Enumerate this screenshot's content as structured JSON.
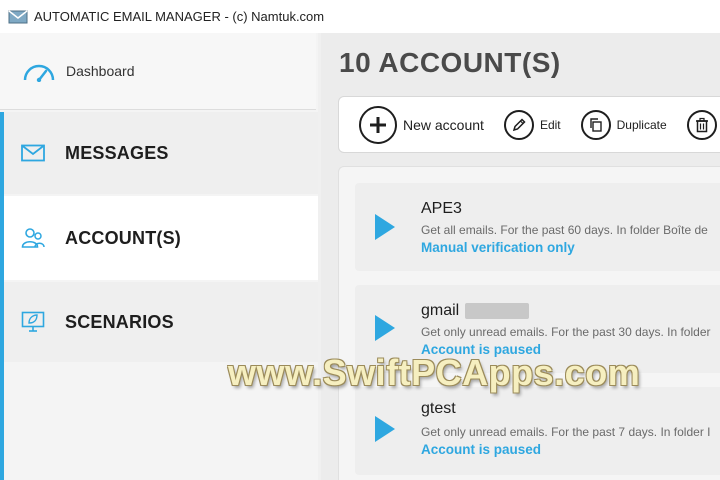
{
  "window": {
    "title": "AUTOMATIC EMAIL MANAGER - (c) Namtuk.com",
    "icon": "envelope-app-icon"
  },
  "sidebar": {
    "dashboard": {
      "label": "Dashboard",
      "icon": "speedometer-icon"
    },
    "items": [
      {
        "label": "MESSAGES",
        "icon": "envelope-icon"
      },
      {
        "label": "ACCOUNT(S)",
        "icon": "users-icon",
        "selected": true
      },
      {
        "label": "SCENARIOS",
        "icon": "monitor-leaf-icon"
      }
    ]
  },
  "main": {
    "title": "10 ACCOUNT(S)",
    "toolbar": {
      "new_account": "New account",
      "edit": "Edit",
      "duplicate": "Duplicate"
    },
    "accounts": [
      {
        "name": "APE3",
        "desc": "Get all emails. For the past 60 days. In folder Boîte de",
        "status": "Manual verification only"
      },
      {
        "name": "gmail",
        "desc": "Get only unread emails. For the past 30 days. In folder",
        "status": "Account is paused"
      },
      {
        "name": "gtest",
        "desc": "Get only unread emails. For the past 7 days. In folder I",
        "status": "Account is paused"
      }
    ]
  },
  "watermark": "www.SwiftPCApps.com",
  "colors": {
    "accent": "#2ea7e0",
    "text": "#1e1e1e",
    "muted": "#6a6a6a"
  }
}
